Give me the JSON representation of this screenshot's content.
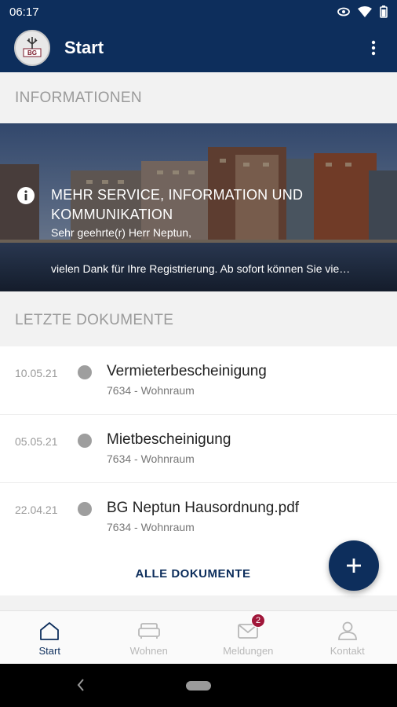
{
  "status_bar": {
    "time": "06:17"
  },
  "app_bar": {
    "title": "Start",
    "logo_text": "BG"
  },
  "sections": {
    "info_header": "INFORMATIONEN",
    "docs_header": "LETZTE DOKUMENTE"
  },
  "hero": {
    "title": "MEHR SERVICE, INFORMATION UND KOMMUNIKATION",
    "greeting": "Sehr geehrte(r) Herr Neptun,",
    "preview": "vielen Dank für Ihre Registrierung. Ab sofort können Sie vie…"
  },
  "documents": [
    {
      "date": "10.05.21",
      "title": "Vermieterbescheinigung",
      "meta": "7634 - Wohnraum"
    },
    {
      "date": "05.05.21",
      "title": "Mietbescheinigung",
      "meta": "7634 - Wohnraum"
    },
    {
      "date": "22.04.21",
      "title": "BG Neptun Hausordnung.pdf",
      "meta": "7634 - Wohnraum"
    }
  ],
  "all_documents_label": "ALLE DOKUMENTE",
  "bottom_nav": {
    "items": [
      {
        "label": "Start",
        "icon": "home-icon"
      },
      {
        "label": "Wohnen",
        "icon": "sofa-icon"
      },
      {
        "label": "Meldungen",
        "icon": "mail-icon",
        "badge": "2"
      },
      {
        "label": "Kontakt",
        "icon": "person-icon"
      }
    ]
  },
  "colors": {
    "primary": "#0d2e5c",
    "badge": "#a0173a"
  }
}
